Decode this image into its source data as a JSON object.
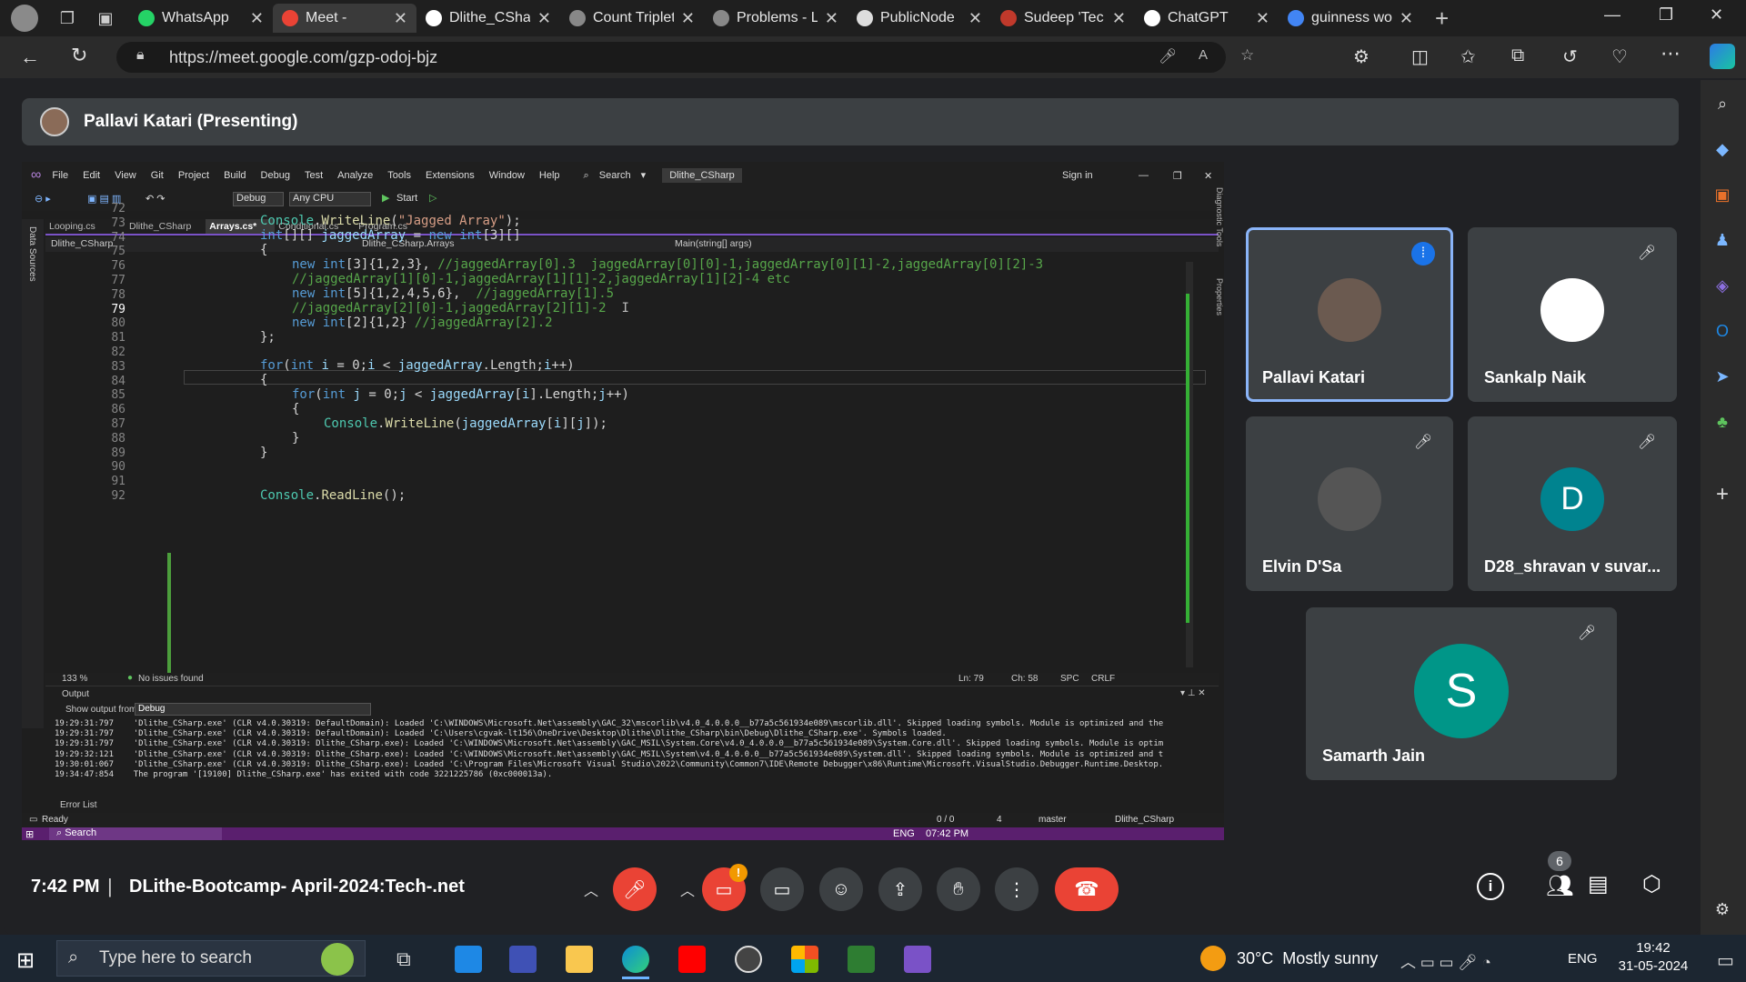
{
  "browser": {
    "tabs": [
      {
        "label": "WhatsApp",
        "color": "#25d366"
      },
      {
        "label": "Meet - ",
        "color": "#ea4335"
      },
      {
        "label": "Dlithe_CShar",
        "color": "#ffffff"
      },
      {
        "label": "Count Triplet",
        "color": "#888888"
      },
      {
        "label": "Problems - L",
        "color": "#888888"
      },
      {
        "label": "PublicNode",
        "color": "#dddddd"
      },
      {
        "label": "Sudeep 'Tec",
        "color": "#c0392b"
      },
      {
        "label": "ChatGPT",
        "color": "#ffffff"
      },
      {
        "label": "guinness wo",
        "color": "#4285f4"
      }
    ],
    "url": "https://meet.google.com/gzp-odoj-bjz"
  },
  "meet": {
    "presenting": "Pallavi Katari (Presenting)",
    "time": "7:42 PM",
    "separator": "|",
    "meeting_name": "DLithe-Bootcamp- April-2024:Tech-.net",
    "participant_count": "6",
    "notification_badge": "!",
    "participants": [
      {
        "name": "Pallavi Katari",
        "initial": "",
        "avatar_color": "#6b5a50",
        "speaking": true
      },
      {
        "name": "Sankalp Naik",
        "initial": "",
        "avatar_color": "#ffffff",
        "speaking": false
      },
      {
        "name": "Elvin D'Sa",
        "initial": "",
        "avatar_color": "#555555",
        "speaking": false
      },
      {
        "name": "D28_shravan v suvar...",
        "initial": "D",
        "avatar_color": "#00838f",
        "speaking": false
      },
      {
        "name": "Samarth Jain",
        "initial": "S",
        "avatar_color": "#009688",
        "speaking": false
      }
    ]
  },
  "vs": {
    "menu": [
      "File",
      "Edit",
      "View",
      "Git",
      "Project",
      "Build",
      "Debug",
      "Test",
      "Analyze",
      "Tools",
      "Extensions",
      "Window",
      "Help"
    ],
    "search": "Search",
    "solution": "Dlithe_CSharp",
    "signin": "Sign in",
    "config": "Debug",
    "platform": "Any CPU",
    "start": "Start",
    "tabs": [
      "Looping.cs",
      "Dlithe_CSharp",
      "Arrays.cs*",
      "Conditional.cs",
      "Program.cs"
    ],
    "active_tab": "Arrays.cs*",
    "nav_project": "Dlithe_CSharp",
    "nav_class": "Dlithe_CSharp.Arrays",
    "nav_method": "Main(string[] args)",
    "side_left": "Data Sources",
    "side_right_1": "Diagnostic Tools",
    "side_right_2": "Properties",
    "zoom": "133 %",
    "issues": "No issues found",
    "position": "Ln: 79",
    "column": "Ch: 58",
    "spc": "SPC",
    "crlf": "CRLF",
    "line_numbers": [
      "72",
      "73",
      "74",
      "75",
      "76",
      "77",
      "78",
      "79",
      "80",
      "81",
      "82",
      "83",
      "84",
      "85",
      "86",
      "87",
      "88",
      "89",
      "90",
      "91",
      "92"
    ],
    "current_line": "79",
    "output_title": "Output",
    "show_output_from": "Show output from:",
    "output_source": "Debug",
    "output_lines": [
      "19:29:31:797    'Dlithe_CSharp.exe' (CLR v4.0.30319: DefaultDomain): Loaded 'C:\\WINDOWS\\Microsoft.Net\\assembly\\GAC_32\\mscorlib\\v4.0_4.0.0.0__b77a5c561934e089\\mscorlib.dll'. Skipped loading symbols. Module is optimized and the",
      "19:29:31:797    'Dlithe_CSharp.exe' (CLR v4.0.30319: DefaultDomain): Loaded 'C:\\Users\\cgvak-lt156\\OneDrive\\Desktop\\Dlithe\\Dlithe_CSharp\\bin\\Debug\\Dlithe_CSharp.exe'. Symbols loaded.",
      "19:29:31:797    'Dlithe_CSharp.exe' (CLR v4.0.30319: Dlithe_CSharp.exe): Loaded 'C:\\WINDOWS\\Microsoft.Net\\assembly\\GAC_MSIL\\System.Core\\v4.0_4.0.0.0__b77a5c561934e089\\System.Core.dll'. Skipped loading symbols. Module is optim",
      "19:29:32:121    'Dlithe_CSharp.exe' (CLR v4.0.30319: Dlithe_CSharp.exe): Loaded 'C:\\WINDOWS\\Microsoft.Net\\assembly\\GAC_MSIL\\System\\v4.0_4.0.0.0__b77a5c561934e089\\System.dll'. Skipped loading symbols. Module is optimized and t",
      "19:30:01:067    'Dlithe_CSharp.exe' (CLR v4.0.30319: Dlithe_CSharp.exe): Loaded 'C:\\Program Files\\Microsoft Visual Studio\\2022\\Community\\Common7\\IDE\\Remote Debugger\\x86\\Runtime\\Microsoft.VisualStudio.Debugger.Runtime.Desktop.",
      "19:34:47:854    The program '[19100] Dlithe_CSharp.exe' has exited with code 3221225786 (0xc000013a)."
    ],
    "error_list": "Error List",
    "status_ready": "Ready",
    "status_errors": "0 / 0",
    "status_pencil": "4",
    "status_branch": "master",
    "status_repo": "Dlithe_CSharp",
    "inner_taskbar_search": "Search",
    "inner_lang": "ENG",
    "inner_time": "07:42 PM"
  },
  "taskbar": {
    "search_placeholder": "Type here to search",
    "weather": "30°C  Mostly sunny",
    "lang": "ENG",
    "time": "19:42",
    "date": "31-05-2024"
  }
}
